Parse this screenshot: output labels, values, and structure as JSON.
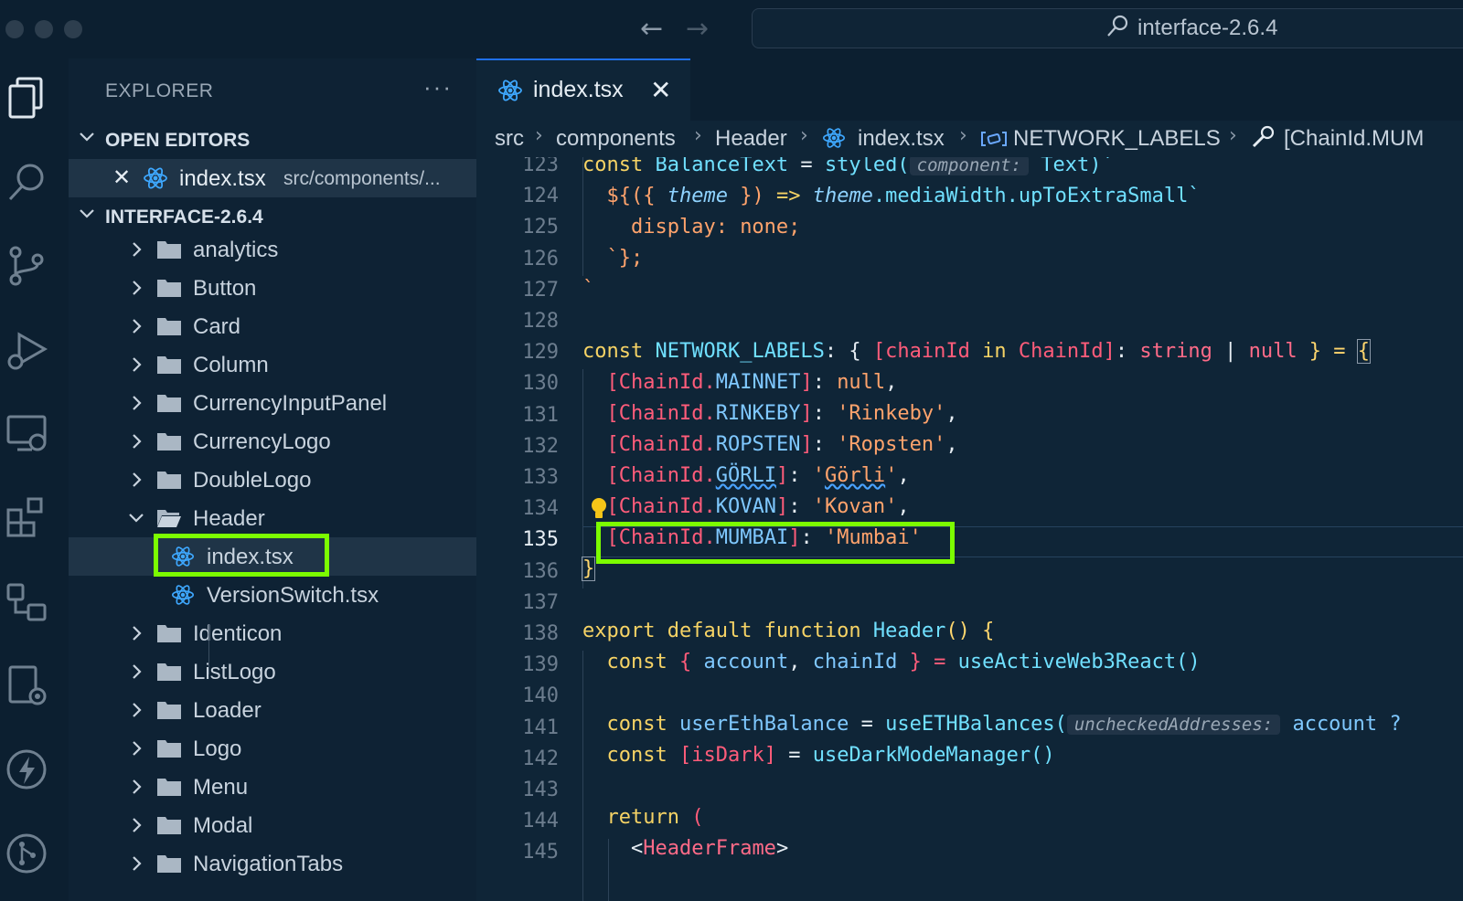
{
  "titlebar": {
    "search_text": "interface-2.6.4"
  },
  "activity_bar": [
    "explorer-icon",
    "search-icon",
    "source-control-icon",
    "run-debug-icon",
    "remote-explorer-icon",
    "extensions-icon",
    "source-graph-icon",
    "settings-sync-icon",
    "lightning-icon",
    "git-graph-icon"
  ],
  "sidebar": {
    "title": "EXPLORER",
    "more": "···",
    "open_editors_label": "OPEN EDITORS",
    "open_editor": {
      "name": "index.tsx",
      "path": "src/components/..."
    },
    "workspace_label": "INTERFACE-2.6.4",
    "tree": [
      {
        "name": "analytics",
        "type": "folder",
        "expanded": false
      },
      {
        "name": "Button",
        "type": "folder",
        "expanded": false
      },
      {
        "name": "Card",
        "type": "folder",
        "expanded": false
      },
      {
        "name": "Column",
        "type": "folder",
        "expanded": false
      },
      {
        "name": "CurrencyInputPanel",
        "type": "folder",
        "expanded": false
      },
      {
        "name": "CurrencyLogo",
        "type": "folder",
        "expanded": false
      },
      {
        "name": "DoubleLogo",
        "type": "folder",
        "expanded": false
      },
      {
        "name": "Header",
        "type": "folder",
        "expanded": true
      },
      {
        "name": "index.tsx",
        "type": "file",
        "selected": true
      },
      {
        "name": "VersionSwitch.tsx",
        "type": "file"
      },
      {
        "name": "Identicon",
        "type": "folder",
        "expanded": false
      },
      {
        "name": "ListLogo",
        "type": "folder",
        "expanded": false
      },
      {
        "name": "Loader",
        "type": "folder",
        "expanded": false
      },
      {
        "name": "Logo",
        "type": "folder",
        "expanded": false
      },
      {
        "name": "Menu",
        "type": "folder",
        "expanded": false
      },
      {
        "name": "Modal",
        "type": "folder",
        "expanded": false
      },
      {
        "name": "NavigationTabs",
        "type": "folder",
        "expanded": false
      }
    ]
  },
  "editor": {
    "tab": {
      "name": "index.tsx",
      "close": "✕"
    },
    "breadcrumbs": [
      "src",
      "components",
      "Header",
      "index.tsx",
      "NETWORK_LABELS",
      "[ChainId.MUM"
    ],
    "active_line": "135",
    "line_numbers": [
      "123",
      "124",
      "125",
      "126",
      "127",
      "128",
      "129",
      "130",
      "131",
      "132",
      "133",
      "134",
      "135",
      "136",
      "137",
      "138",
      "139",
      "140",
      "141",
      "142",
      "143",
      "144",
      "145"
    ],
    "code": {
      "l123a": "const ",
      "l123b": "BalanceText",
      "l123c": " = ",
      "l123d": "styled(",
      "l123hint": "component:",
      "l123e": " Text)`",
      "l124a": "${({ ",
      "l124b": "theme",
      "l124c": " }) ",
      "l124d": "=> ",
      "l124e": "theme",
      "l124f": ".mediaWidth.upToExtraSmall`",
      "l125": "display: none;",
      "l126": "`};",
      "l127": "`",
      "l129a": "const ",
      "l129b": "NETWORK_LABELS",
      "l129c": ": { ",
      "l129d": "[chainId ",
      "l129e": "in ",
      "l129f": "ChainId]",
      "l129g": ": ",
      "l129h": "string",
      "l129i": " | ",
      "l129j": "null",
      "l129k": " } = ",
      "l129l": "{",
      "l130a": "[ChainId.",
      "l130b": "MAINNET",
      "l130c": "]",
      "l130d": ": ",
      "l130e": "null",
      "l131a": "[ChainId.",
      "l131b": "RINKEBY",
      "l131c": "]",
      "l131d": ": ",
      "l131e": "'Rinkeby'",
      "l132a": "[ChainId.",
      "l132b": "ROPSTEN",
      "l132c": "]",
      "l132d": ": ",
      "l132e": "'Ropsten'",
      "l133a": "[ChainId.",
      "l133b": "GÖRLI",
      "l133c": "]",
      "l133d": ": ",
      "l133e": "'",
      "l133f": "Görli",
      "l133g": "'",
      "l134a": "[ChainId.",
      "l134b": "KOVAN",
      "l134c": "]",
      "l134d": ": ",
      "l134e": "'Kovan'",
      "l135a": "[ChainId.",
      "l135b": "MUMBAI",
      "l135c": "]",
      "l135d": ": ",
      "l135e": "'Mumbai'",
      "l136": "}",
      "l138a": "export default function ",
      "l138b": "Header",
      "l138c": "() {",
      "l139a": "const ",
      "l139b": "{ ",
      "l139c": "account",
      "l139d": ", ",
      "l139e": "chainId",
      "l139f": " } = ",
      "l139g": "useActiveWeb3React()",
      "l141a": "const ",
      "l141b": "userEthBalance",
      "l141c": " = ",
      "l141d": "useETHBalances(",
      "l141hint": "uncheckedAddresses:",
      "l141e": " account ?",
      "l142a": "const ",
      "l142b": "[isDark]",
      "l142c": " = ",
      "l142d": "useDarkModeManager()",
      "l144a": "return ",
      "l144b": "(",
      "l145a": "<",
      "l145b": "HeaderFrame",
      "l145c": ">"
    }
  },
  "colors": {
    "highlight": "#7cfc00",
    "accent": "#1f6feb"
  }
}
